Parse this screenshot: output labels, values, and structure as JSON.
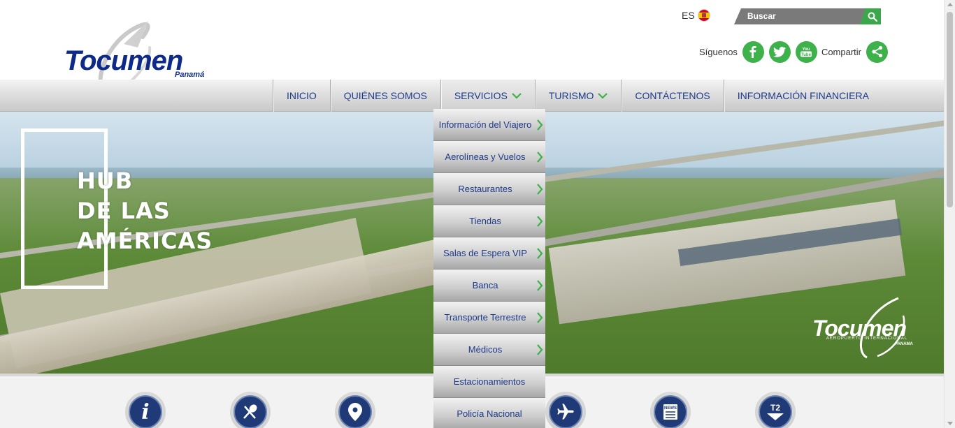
{
  "header": {
    "logo": {
      "name": "Tocumen",
      "subtitle": "Panamá"
    },
    "language": {
      "code": "ES",
      "flag_icon": "spain-flag-icon"
    },
    "search": {
      "placeholder": "Buscar",
      "icon": "search-icon"
    },
    "social": {
      "follow_label": "Síguenos",
      "networks": [
        "facebook-icon",
        "twitter-icon",
        "youtube-icon"
      ],
      "share_label": "Compartir",
      "share_icon": "share-icon"
    }
  },
  "nav": {
    "items": [
      {
        "label": "INICIO",
        "dropdown": false
      },
      {
        "label": "QUIÉNES SOMOS",
        "dropdown": false
      },
      {
        "label": "SERVICIOS",
        "dropdown": true
      },
      {
        "label": "TURISMO",
        "dropdown": true
      },
      {
        "label": "CONTÁCTENOS",
        "dropdown": false
      },
      {
        "label": "INFORMACIÓN FINANCIERA",
        "dropdown": false
      }
    ]
  },
  "services_menu": {
    "items": [
      {
        "label": "Información del Viajero",
        "submenu": true
      },
      {
        "label": "Aerolíneas y Vuelos",
        "submenu": true
      },
      {
        "label": "Restaurantes",
        "submenu": true
      },
      {
        "label": "Tiendas",
        "submenu": true
      },
      {
        "label": "Salas de Espera VIP",
        "submenu": true
      },
      {
        "label": "Banca",
        "submenu": true
      },
      {
        "label": "Transporte Terrestre",
        "submenu": true
      },
      {
        "label": "Médicos",
        "submenu": true
      },
      {
        "label": "Estacionamientos",
        "submenu": false
      },
      {
        "label": "Policía Nacional",
        "submenu": false
      }
    ]
  },
  "hero": {
    "lines": [
      "HUB",
      "DE LAS",
      "AMÉRICAS"
    ],
    "logo_name": "Tocumen",
    "logo_subtitle": "AEROPUERTO INTERNACIONAL",
    "logo_country": "PANAMA"
  },
  "quick_links": {
    "icons": [
      "info-icon",
      "restaurant-icon",
      "location-pin-icon",
      "airplane-icon",
      "news-icon",
      "t2-terminal-icon"
    ],
    "news_label": "NEWS",
    "t2_label": "T2"
  },
  "colors": {
    "brand_blue": "#0d2a8a",
    "nav_text": "#1d3a8a",
    "accent_green": "#3db14a",
    "search_gray": "#7a7a7a"
  }
}
